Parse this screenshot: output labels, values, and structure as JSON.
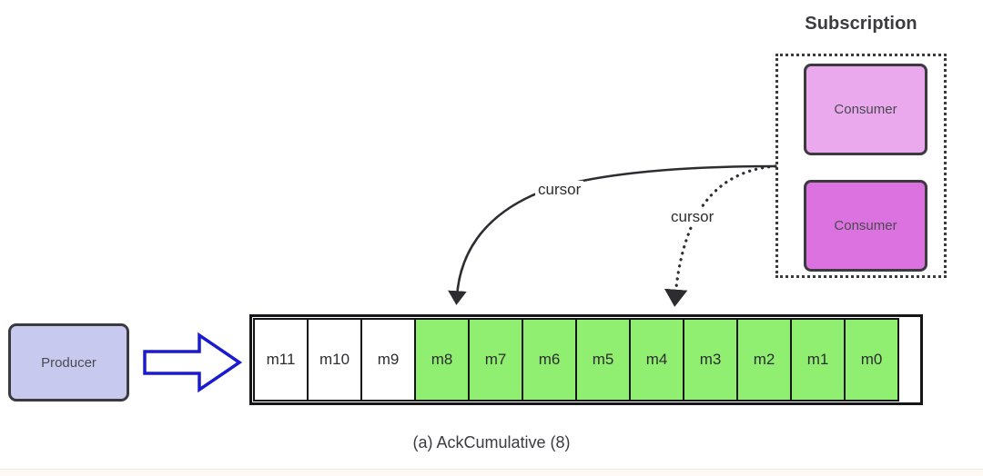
{
  "subscription": {
    "title": "Subscription",
    "consumers": [
      {
        "label": "Consumer",
        "color": "#e9a9ec"
      },
      {
        "label": "Consumer",
        "color": "#dc72e0"
      }
    ]
  },
  "producer": {
    "label": "Producer",
    "color": "#c8c9ef"
  },
  "queue": {
    "cells": [
      {
        "label": "m11",
        "state": "unacked"
      },
      {
        "label": "m10",
        "state": "unacked"
      },
      {
        "label": "m9",
        "state": "unacked"
      },
      {
        "label": "m8",
        "state": "acked"
      },
      {
        "label": "m7",
        "state": "acked"
      },
      {
        "label": "m6",
        "state": "acked"
      },
      {
        "label": "m5",
        "state": "acked"
      },
      {
        "label": "m4",
        "state": "acked"
      },
      {
        "label": "m3",
        "state": "acked"
      },
      {
        "label": "m2",
        "state": "acked"
      },
      {
        "label": "m1",
        "state": "acked"
      },
      {
        "label": "m0",
        "state": "acked"
      }
    ],
    "acked_color": "#90ee70",
    "unacked_color": "#ffffff"
  },
  "cursors": [
    {
      "label": "cursor",
      "style": "solid",
      "target": "m8"
    },
    {
      "label": "cursor",
      "style": "dotted",
      "target": "m4"
    }
  ],
  "caption": "(a) AckCumulative (8)",
  "colors": {
    "stroke": "#3a3a3f",
    "arrow_blue": "#1a1ad0",
    "background": "#ffffff"
  }
}
